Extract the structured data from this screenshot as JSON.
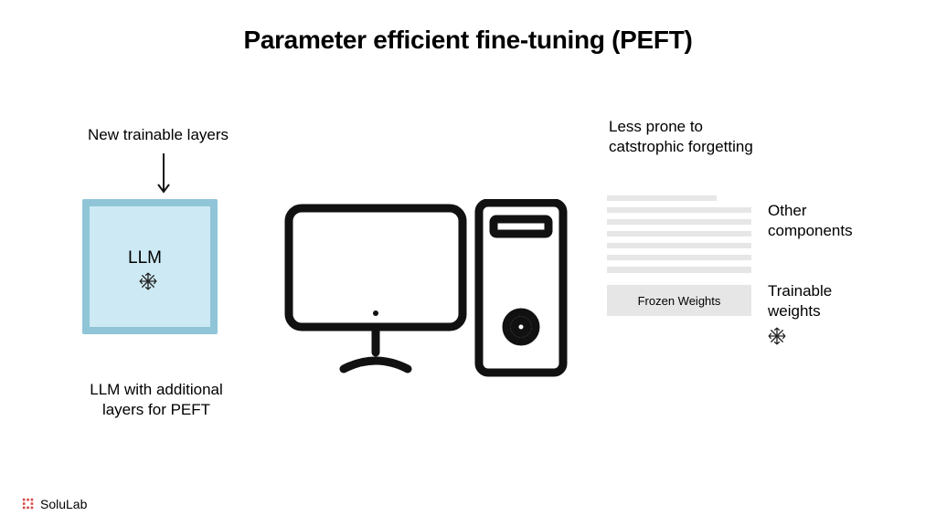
{
  "title": "Parameter efficient fine-tuning (PEFT)",
  "left": {
    "new_layers_label": "New trainable layers",
    "llm_label": "LLM",
    "caption": "LLM with additional layers for PEFT"
  },
  "right": {
    "less_prone": "Less prone to catstrophic forgetting",
    "other_components": "Other components",
    "trainable_weights": "Trainable weights",
    "frozen_weights": "Frozen Weights"
  },
  "brand": {
    "name": "SoluLab"
  },
  "icons": {
    "snowflake": "snowflake-icon",
    "computer": "computer-icon",
    "arrow_down": "arrow-down-icon",
    "brand_mark": "brand-mark-icon"
  },
  "colors": {
    "box_outer": "#90c5d7",
    "box_inner": "#cdeaf4",
    "stack_line": "#e6e6e6",
    "brand_accent": "#d64a4a"
  }
}
